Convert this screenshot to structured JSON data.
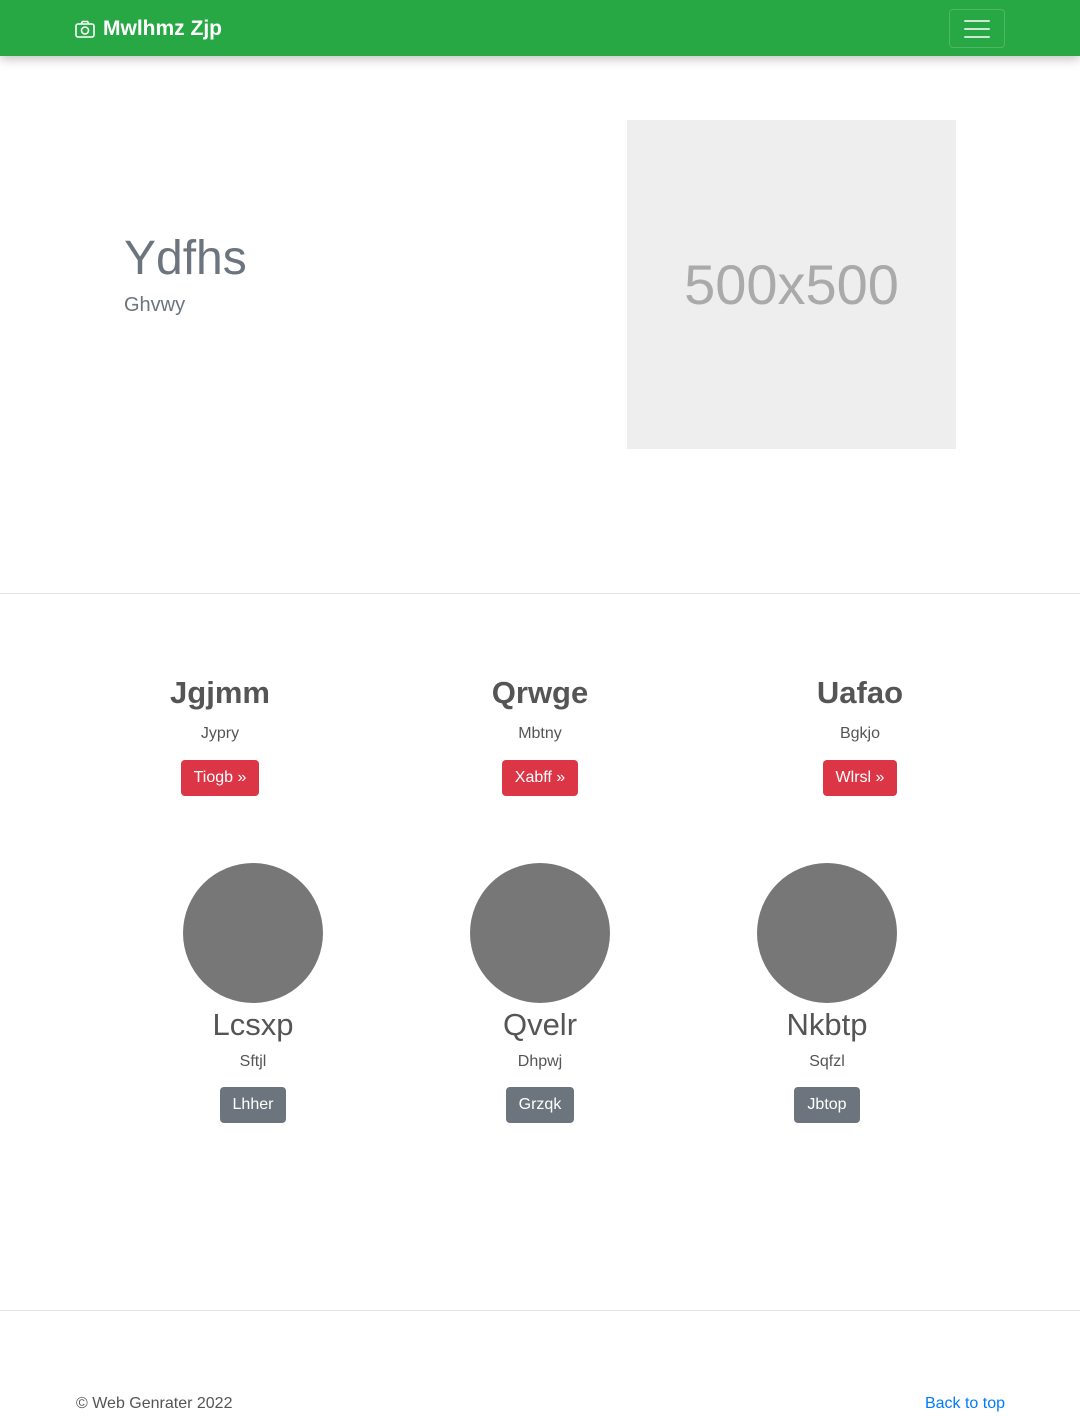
{
  "navbar": {
    "brand": "Mwlhmz Zjp",
    "brand_icon": "camera-icon",
    "toggler_icon": "hamburger-menu-icon",
    "color": "#28a745"
  },
  "hero": {
    "title": "Ydfhs",
    "subtitle": "Ghvwy",
    "image_placeholder": "500x500"
  },
  "features": [
    {
      "title": "Jgjmm",
      "text": "Jypry",
      "button": "Tiogb »"
    },
    {
      "title": "Qrwge",
      "text": "Mbtny",
      "button": "Xabff »"
    },
    {
      "title": "Uafao",
      "text": "Bgkjo",
      "button": "Wlrsl »"
    }
  ],
  "people": [
    {
      "name": "Lcsxp",
      "text": "Sftjl",
      "button": "Lhher"
    },
    {
      "name": "Qvelr",
      "text": "Dhpwj",
      "button": "Grzqk"
    },
    {
      "name": "Nkbtp",
      "text": "Sqfzl",
      "button": "Jbtop"
    }
  ],
  "footer": {
    "copyright": "© Web Genrater 2022",
    "back_to_top": "Back to top"
  },
  "colors": {
    "accent": "#28a745",
    "danger": "#dc3545",
    "secondary": "#6c757d",
    "link": "#007bff"
  }
}
